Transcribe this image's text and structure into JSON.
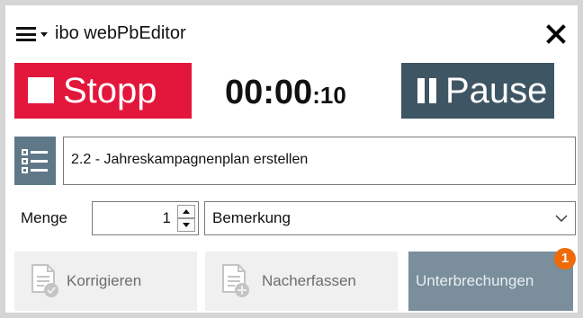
{
  "header": {
    "title": "ibo webPbEditor",
    "menu_icon": "hamburger-icon",
    "close_icon": "close-icon"
  },
  "controls": {
    "stop_label": "Stopp",
    "timer_main": "00:00",
    "timer_sub": ":10",
    "pause_label": "Pause"
  },
  "task": {
    "list_icon": "list-icon",
    "value": "2.2 - Jahreskampagnenplan erstellen"
  },
  "quantity": {
    "label": "Menge",
    "value": "1"
  },
  "remark": {
    "selected": "Bemerkung"
  },
  "actions": {
    "correct_label": "Korrigieren",
    "followup_label": "Nacherfassen",
    "interruptions_label": "Unterbrechungen",
    "interruptions_badge": "1"
  },
  "colors": {
    "stop": "#e3163c",
    "pause": "#3e5563",
    "list_button": "#5e7888",
    "interruptions": "#7a8e9b",
    "badge": "#ef6b0a"
  }
}
